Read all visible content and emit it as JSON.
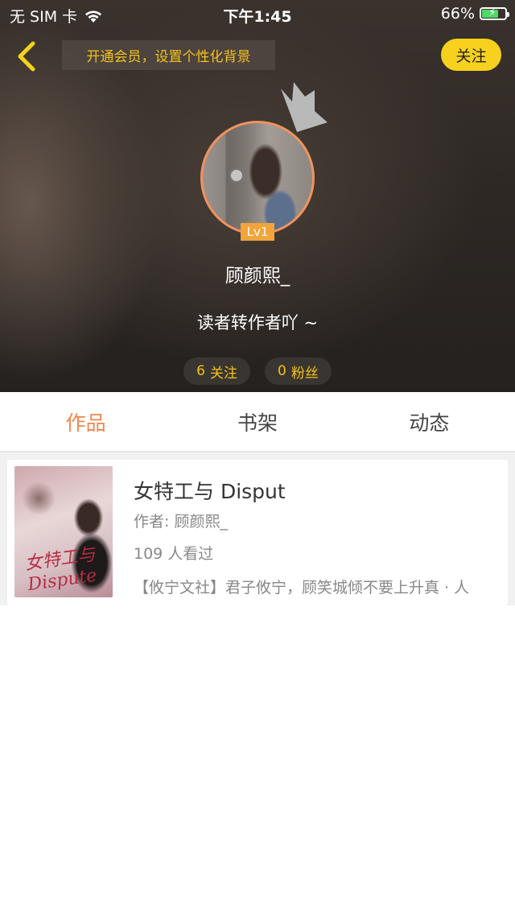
{
  "status_bar": {
    "carrier": "无 SIM 卡",
    "time": "下午1:45",
    "battery": "66%",
    "battery_level": 0.66
  },
  "header": {
    "vip_banner": "开通会员，设置个性化背景",
    "follow_label": "关注"
  },
  "profile": {
    "level": "Lv1",
    "username": "顾颜熙_",
    "bio": "读者转作者吖 ~",
    "following_count": "6",
    "following_label": "关注",
    "fans_count": "0",
    "fans_label": "粉丝"
  },
  "tabs": [
    {
      "label": "作品",
      "active": true
    },
    {
      "label": "书架",
      "active": false
    },
    {
      "label": "动态",
      "active": false
    }
  ],
  "books": [
    {
      "title": "女特工与 Disput",
      "author": "作者: 顾颜熙_",
      "views": "109 人看过",
      "description": "【攸宁文社】君子攸宁，顾笑城倾不要上升真 · 人",
      "cover_text": "女特工与Dispute"
    }
  ],
  "colors": {
    "accent_orange": "#f0874d",
    "vip_yellow": "#f6c21a",
    "follow_button": "#f7d11d"
  }
}
